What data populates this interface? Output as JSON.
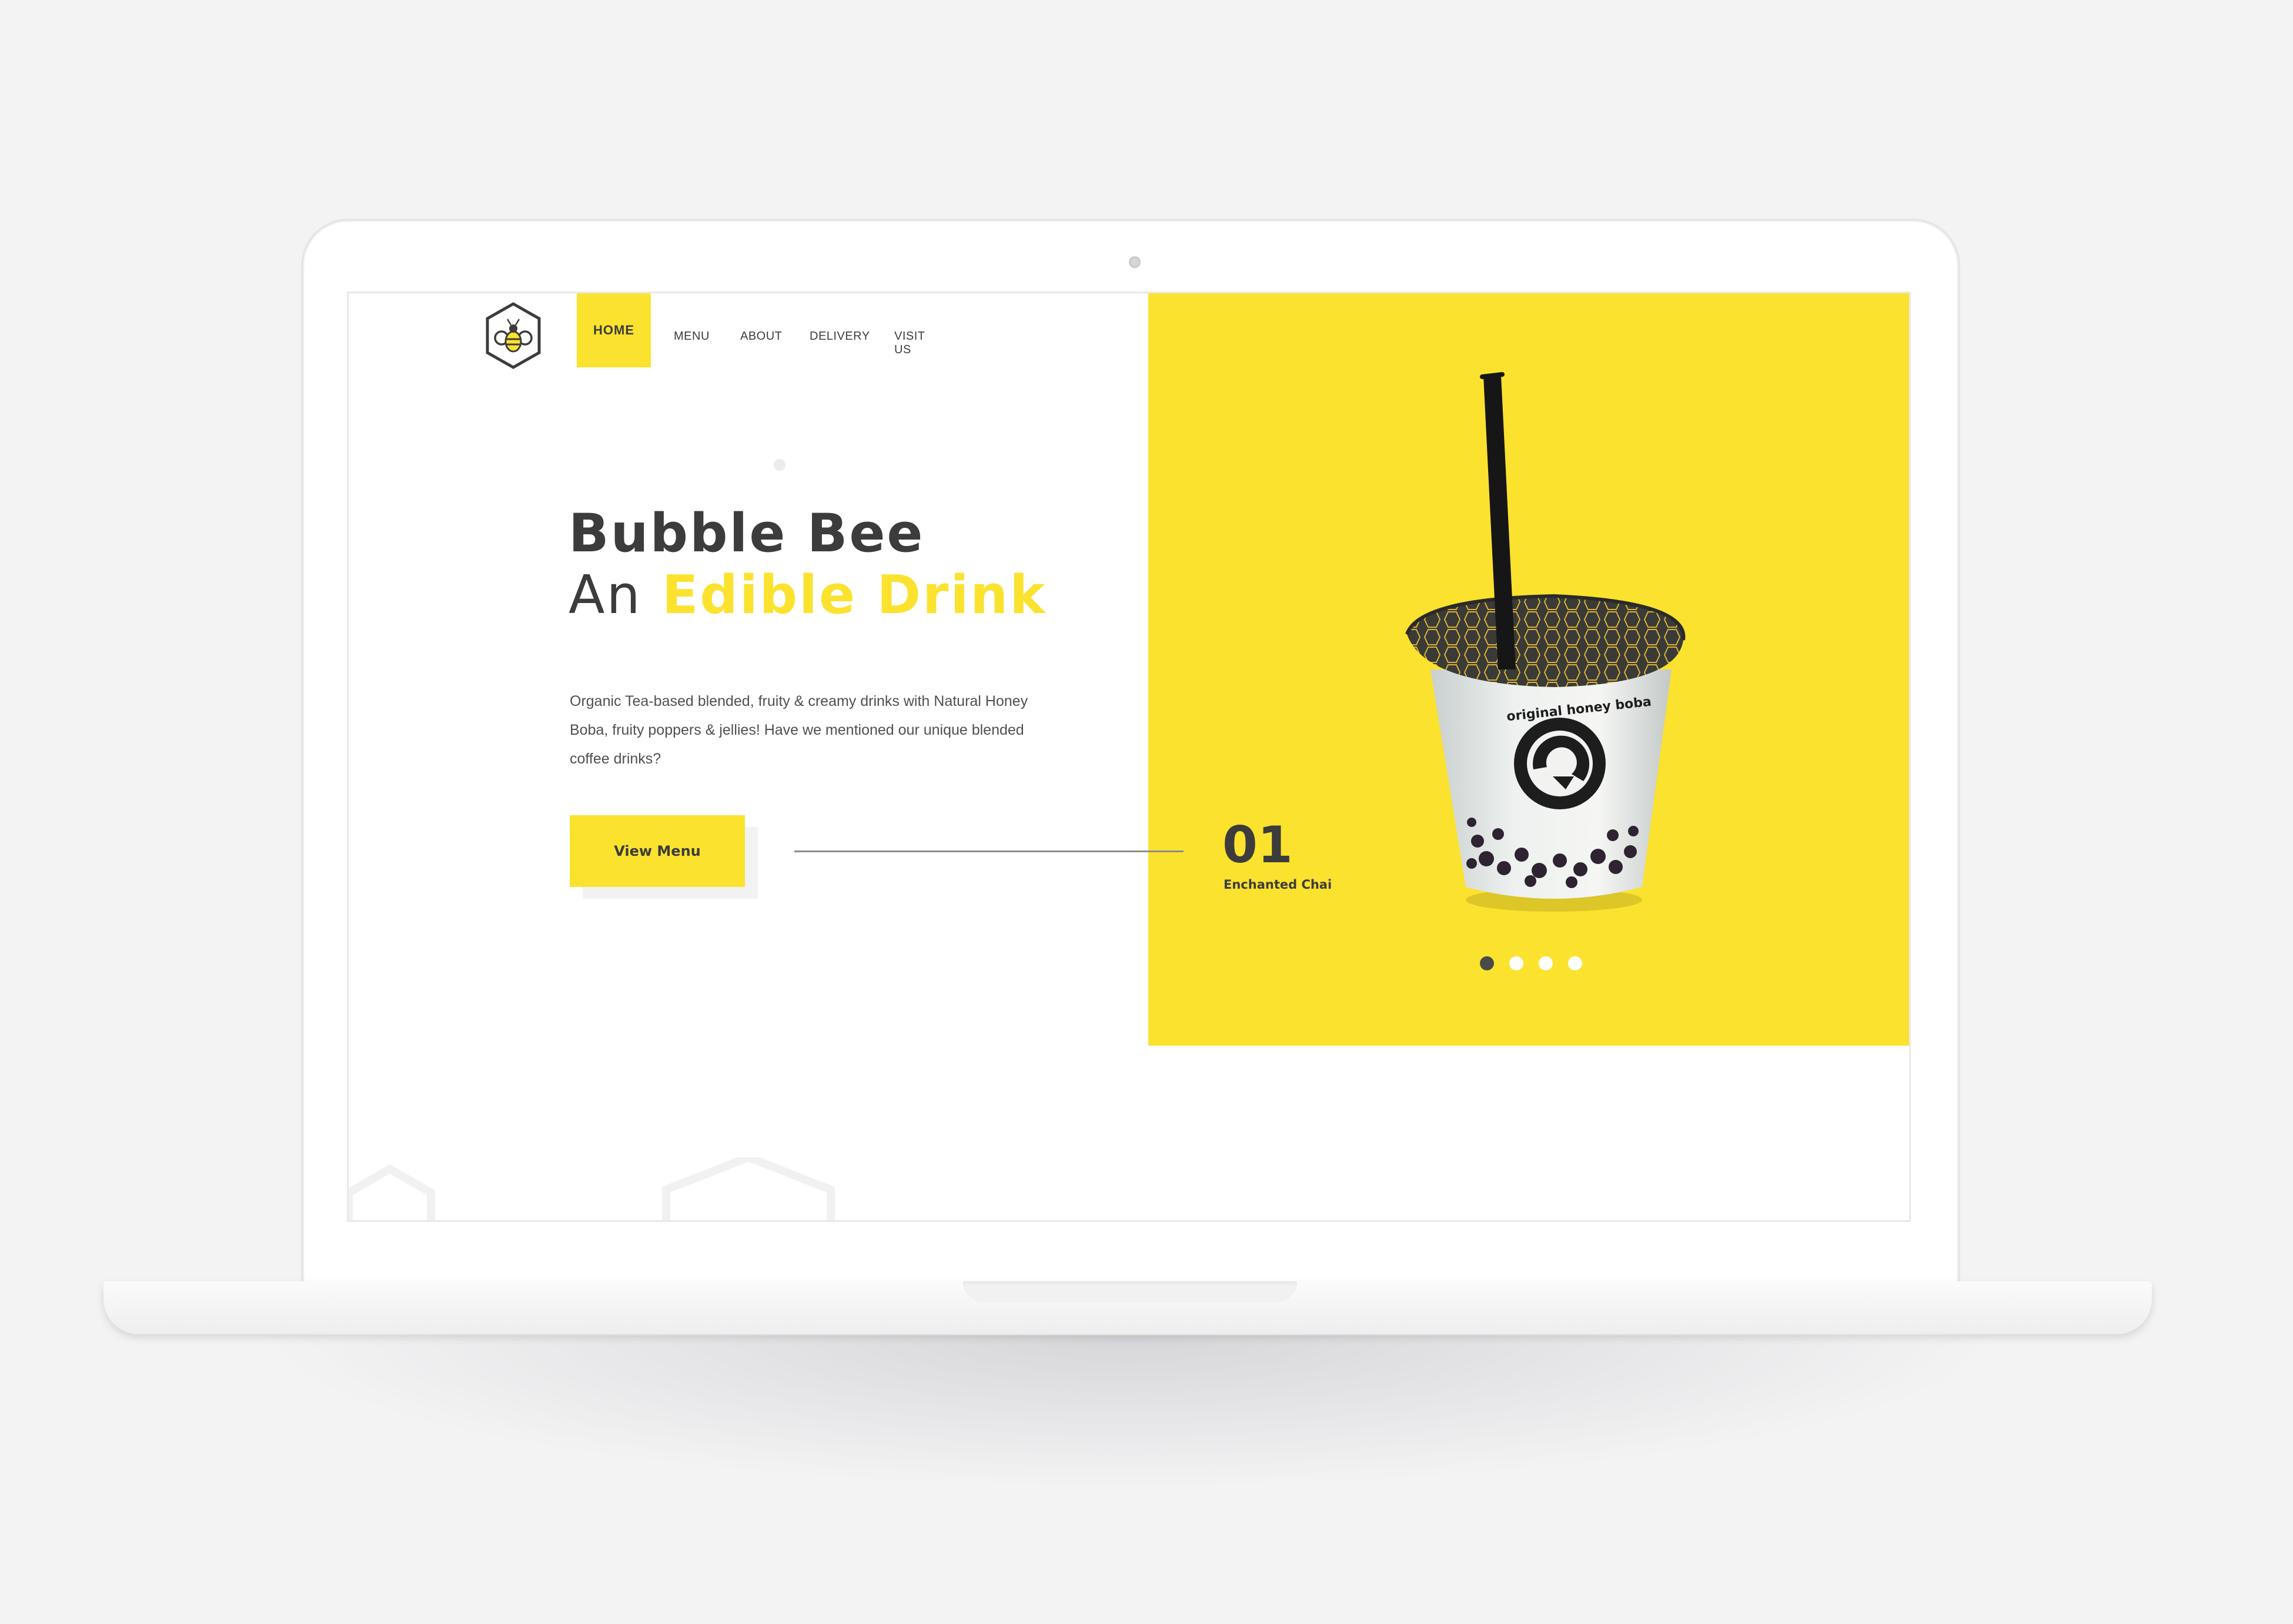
{
  "nav": {
    "home": "HOME",
    "menu": "MENU",
    "about": "ABOUT",
    "delivery": "DELIVERY",
    "visit_us": "VISIT US"
  },
  "hero": {
    "title_line1": "Bubble Bee",
    "title_line2_prefix": "An",
    "title_line2_accent": "Edible Drink",
    "description": "Organic Tea-based blended, fruity & creamy drinks with Natural Honey Boba, fruity poppers & jellies! Have we mentioned our unique blended coffee drinks?",
    "cta_label": "View Menu"
  },
  "slide": {
    "number": "01",
    "name": "Enchanted Chai",
    "total": 4,
    "current": 1
  },
  "cup_text": "original honey boba",
  "colors": {
    "accent": "#fbe22e",
    "text": "#3c3c3c",
    "background": "#ffffff"
  },
  "icons": {
    "logo": "bee-hexagon-logo",
    "product": "bubble-tea-cup"
  }
}
